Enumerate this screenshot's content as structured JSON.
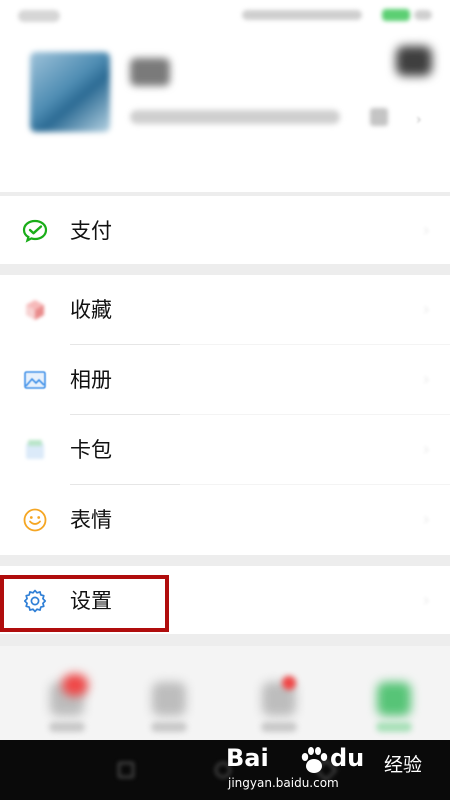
{
  "menu": {
    "pay_label": "支付",
    "favorites_label": "收藏",
    "album_label": "相册",
    "cards_label": "卡包",
    "stickers_label": "表情",
    "settings_label": "设置"
  },
  "icons": {
    "pay": "wechat-pay-icon",
    "favorites": "favorites-cube-icon",
    "album": "photo-album-icon",
    "cards": "card-wallet-icon",
    "stickers": "smiley-icon",
    "settings": "gear-icon"
  },
  "colors": {
    "pay_green": "#1aad19",
    "album_blue": "#3d8fe8",
    "sticker_orange": "#f5a623",
    "settings_blue": "#2f7fd6",
    "highlight_red": "#b00d0d"
  },
  "watermark": {
    "brand_a": "Bai",
    "brand_b": "du",
    "product": "经验",
    "url": "jingyan.baidu.com"
  }
}
